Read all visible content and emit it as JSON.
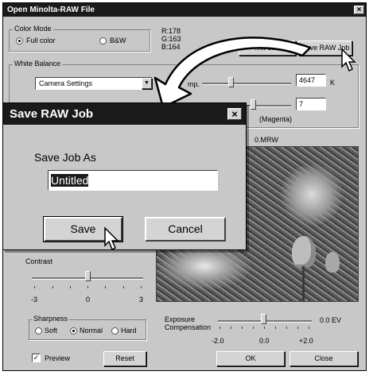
{
  "window": {
    "title": "Open Minolta-RAW File",
    "close_glyph": "×"
  },
  "color_mode": {
    "label": "Color Mode",
    "full_color": "Full color",
    "bw": "B&W",
    "selected": "Full color"
  },
  "rgb_readout": {
    "r": "R:178",
    "g": "G:163",
    "b": "B:164"
  },
  "buttons": {
    "load_raw_job": "...w Job",
    "save_raw_job": "Save RAW Job",
    "ok": "OK",
    "close": "Close",
    "reset": "Reset"
  },
  "white_balance": {
    "label": "White Balance",
    "selected": "Camera Settings",
    "temp_label": "mp.",
    "temp_value": "4647",
    "temp_unit": "K",
    "tint_value": "7",
    "tint_label": "(Magenta)"
  },
  "filename_fragment": "0.MRW",
  "contrast": {
    "label": "Contrast",
    "min": "-3",
    "mid": "0",
    "max": "3",
    "level": 0
  },
  "sharpness": {
    "label": "Sharpness",
    "soft": "Soft",
    "normal": "Normal",
    "hard": "Hard",
    "selected": "Normal"
  },
  "exposure": {
    "label_line1": "Exposure",
    "label_line2": "Compensation",
    "value": "0.0 EV",
    "min": "-2.0",
    "mid": "0.0",
    "max": "+2.0"
  },
  "preview": {
    "label": "Preview",
    "checked": true,
    "check_glyph": "✓"
  },
  "save_dialog": {
    "title": "Save RAW Job",
    "prompt": "Save Job As",
    "input_value": "Untitled",
    "save": "Save",
    "cancel": "Cancel",
    "close_glyph": "×"
  },
  "colors": {
    "titlebar": "#1a1a1a",
    "face": "#c8c8c8",
    "selection": "#1a1a1a"
  }
}
